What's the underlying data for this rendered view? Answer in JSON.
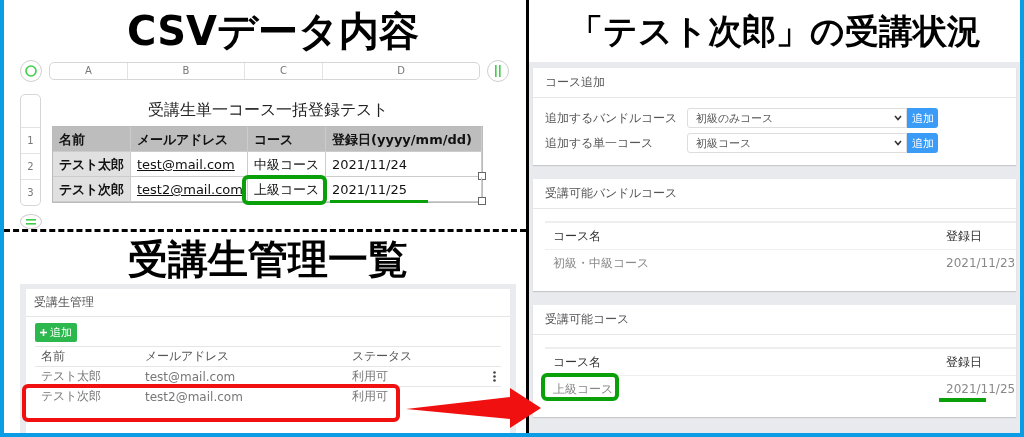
{
  "csv_section": {
    "title": "CSVデータ内容",
    "columns": [
      "A",
      "B",
      "C",
      "D"
    ],
    "row_numbers": [
      "1",
      "2",
      "3"
    ],
    "table_title": "受講生単一コース一括登録テスト",
    "header": [
      "名前",
      "メールアドレス",
      "コース",
      "登録日(yyyy/mm/dd)"
    ],
    "rows": [
      {
        "cells": [
          "テスト太郎",
          "test@mail.com",
          "中級コース",
          "2021/11/24"
        ],
        "highlighted": false
      },
      {
        "cells": [
          "テスト次郎",
          "test2@mail.com",
          "上級コース",
          "2021/11/25"
        ],
        "highlighted": true
      }
    ]
  },
  "admin_section": {
    "title": "受講生管理一覧",
    "card_title": "受講生管理",
    "add_button": "追加",
    "columns": [
      "名前",
      "メールアドレス",
      "ステータス"
    ],
    "rows": [
      {
        "name": "テスト太郎",
        "email": "test@mail.com",
        "status": "利用可",
        "menu_icon": true,
        "highlighted": false
      },
      {
        "name": "テスト次郎",
        "email": "test2@mail.com",
        "status": "利用可",
        "menu_icon": false,
        "highlighted": true
      }
    ]
  },
  "status_section": {
    "title": "「テスト次郎」の受講状況",
    "add_card": {
      "title": "コース追加",
      "rows": [
        {
          "label": "追加するバンドルコース",
          "value": "初級のみコース",
          "button": "追加"
        },
        {
          "label": "追加する単一コース",
          "value": "初級コース",
          "button": "追加"
        }
      ]
    },
    "course_cards": [
      {
        "title": "受講可能バンドルコース",
        "columns": [
          "コース名",
          "登録日"
        ],
        "rows": [
          {
            "name": "初級・中級コース",
            "date": "2021/11/23",
            "highlighted": false
          }
        ]
      },
      {
        "title": "受講可能コース",
        "columns": [
          "コース名",
          "登録日"
        ],
        "rows": [
          {
            "name": "上級コース",
            "date": "2021/11/25",
            "highlighted": true
          }
        ]
      }
    ]
  }
}
